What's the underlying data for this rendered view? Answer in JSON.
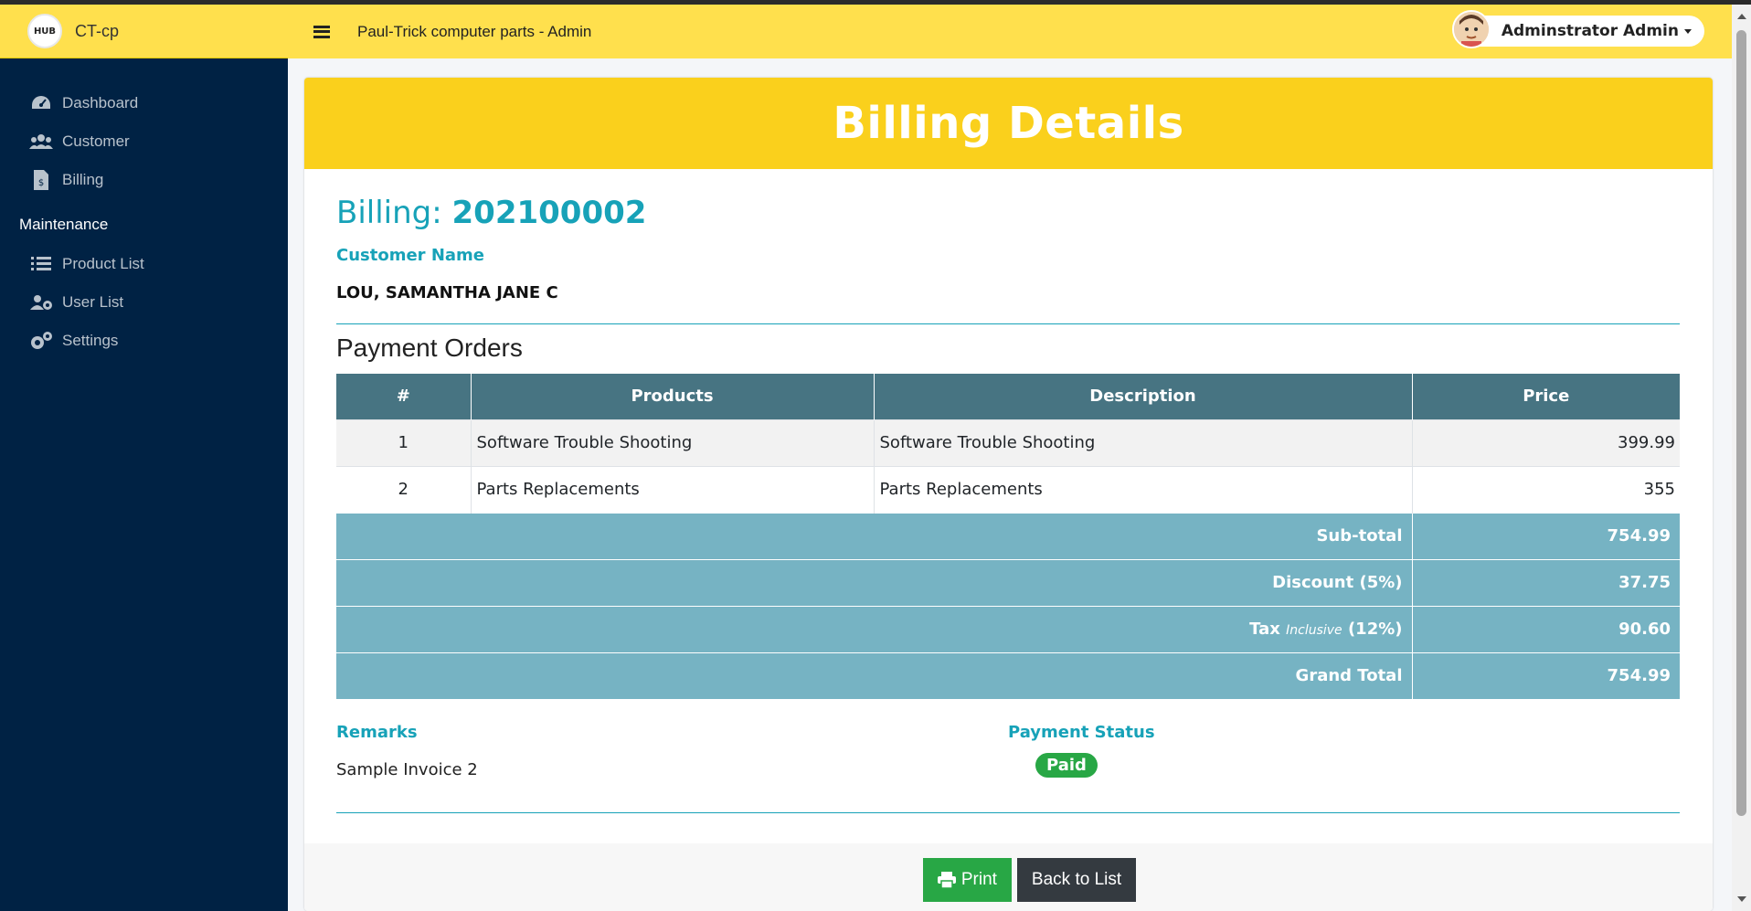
{
  "app": {
    "brand_badge": "HUB",
    "brand_name": "CT-cp",
    "header_title": "Paul-Trick computer parts - Admin",
    "user_name": "Adminstrator Admin"
  },
  "sidebar": {
    "items": [
      {
        "label": "Dashboard",
        "icon": "dashboard-icon"
      },
      {
        "label": "Customer",
        "icon": "users-icon"
      },
      {
        "label": "Billing",
        "icon": "invoice-icon"
      }
    ],
    "section_header": "Maintenance",
    "maintenance_items": [
      {
        "label": "Product List",
        "icon": "list-icon"
      },
      {
        "label": "User List",
        "icon": "user-cog-icon"
      },
      {
        "label": "Settings",
        "icon": "gears-icon"
      }
    ]
  },
  "page": {
    "heading": "Billing Details",
    "billing_label": "Billing:",
    "billing_number": "202100002",
    "customer_label": "Customer Name",
    "customer_name": "LOU, SAMANTHA JANE C",
    "orders_title": "Payment Orders"
  },
  "table": {
    "headers": [
      "#",
      "Products",
      "Description",
      "Price"
    ],
    "rows": [
      {
        "num": "1",
        "product": "Software Trouble Shooting",
        "description": "Software Trouble Shooting",
        "price": "399.99"
      },
      {
        "num": "2",
        "product": "Parts Replacements",
        "description": "Parts Replacements",
        "price": "355"
      }
    ],
    "subtotal_label": "Sub-total",
    "subtotal_value": "754.99",
    "discount_label": "Discount (5%)",
    "discount_value": "37.75",
    "tax_label": "Tax",
    "tax_inclusive": "Inclusive",
    "tax_rate": "(12%)",
    "tax_value": "90.60",
    "grand_total_label": "Grand Total",
    "grand_total_value": "754.99"
  },
  "footer_info": {
    "remarks_label": "Remarks",
    "remarks_value": "Sample Invoice 2",
    "status_label": "Payment Status",
    "status_value": "Paid"
  },
  "actions": {
    "print_label": "Print",
    "back_label": "Back to List"
  },
  "colors": {
    "accent_yellow": "#fad01c",
    "header_yellow": "#ffe04d",
    "sidebar_bg": "#002244",
    "info": "#17a2b8",
    "table_head": "#477482",
    "summary_bg": "#76b3c3",
    "success": "#28a745",
    "dark_button": "#343a40"
  }
}
